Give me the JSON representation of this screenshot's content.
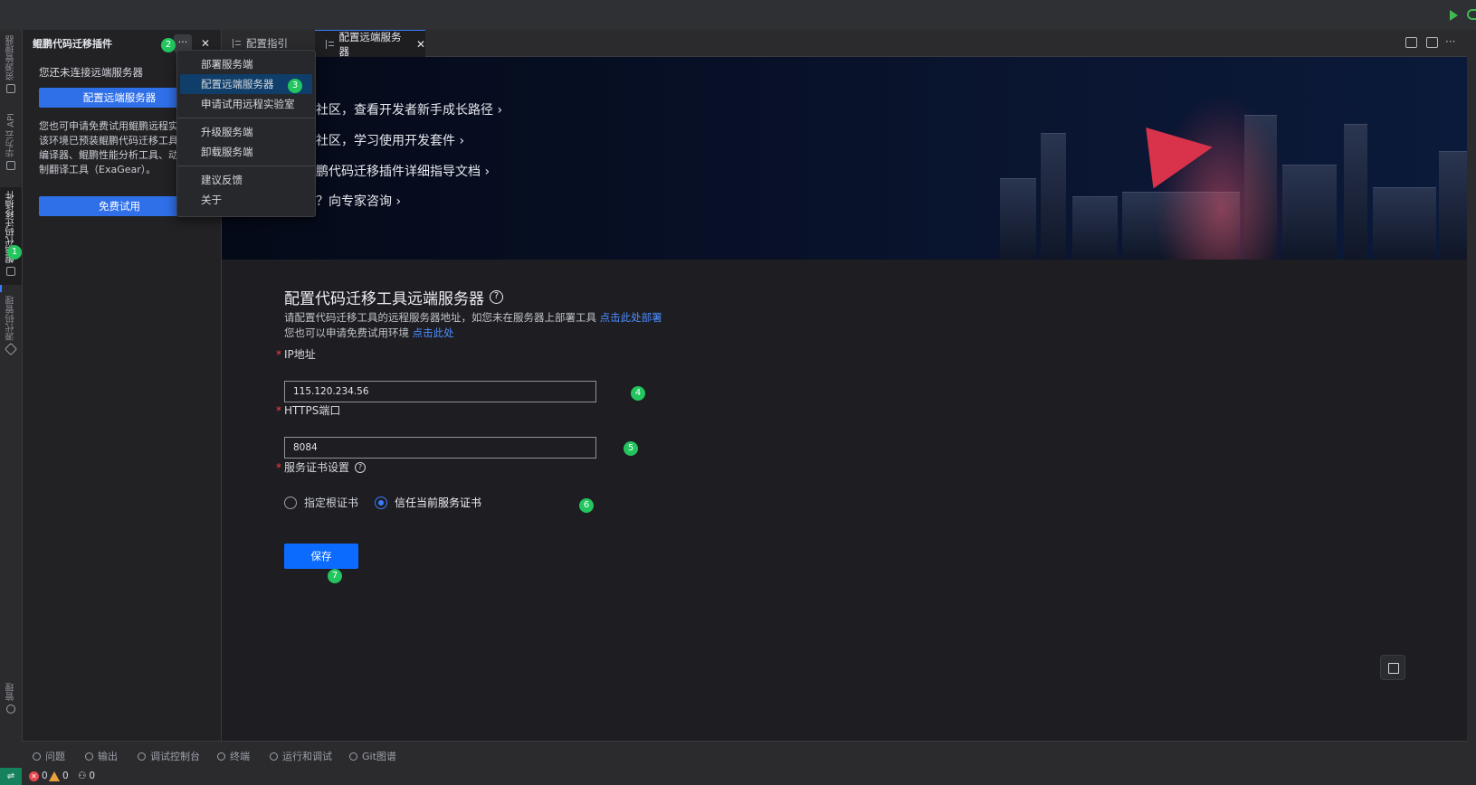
{
  "sidebar": {
    "title": "鲲鹏代码迁移插件",
    "status": "您还未连接远端服务器",
    "config_button": "配置远端服务器",
    "description": "您也可申请免费试用鲲鹏远程实验室，该环境已预装鲲鹏代码迁移工具、鲲鹏编译器、鲲鹏性能分析工具、动态二进制翻译工具（ExaGear）。",
    "trial_button": "免费试用",
    "more_label": "···",
    "close_label": "✕"
  },
  "activity_bar": {
    "items": [
      "资源管理器",
      "华为云 API",
      "鲲鹏代码迁移插件",
      "源代码管理",
      "管理"
    ]
  },
  "menu": {
    "items": [
      "部署服务端",
      "配置远端服务器",
      "申请试用远程实验室",
      "升级服务端",
      "卸载服务端",
      "建议反馈",
      "关于"
    ],
    "selected": "配置远端服务器"
  },
  "markers": [
    "1",
    "2",
    "3",
    "4",
    "5",
    "6",
    "7"
  ],
  "tabs": [
    {
      "label": "配置指引"
    },
    {
      "label": "配置远端服务器",
      "close": "✕"
    }
  ],
  "banner": {
    "lines": [
      "鹏社区，查看开发者新手成长路径 ›",
      "鹏社区，学习使用开发套件 ›",
      "鲲鹏代码迁移插件详细指导文档 ›",
      "问？向专家咨询 ›"
    ]
  },
  "form": {
    "title": "配置代码迁移工具远端服务器",
    "desc1": "请配置代码迁移工具的远程服务器地址，如您未在服务器上部署工具",
    "desc1_link": "点击此处部署",
    "desc2": "您也可以申请免费试用环境",
    "desc2_link": "点击此处",
    "ip_label": "IP地址",
    "ip_value": "115.120.234.56",
    "port_label": "HTTPS端口",
    "port_value": "8084",
    "cert_label": "服务证书设置",
    "radio_root": "指定根证书",
    "radio_trust": "信任当前服务证书",
    "radio_selected": "信任当前服务证书",
    "save": "保存",
    "required_mark": "*",
    "help_mark": "?"
  },
  "panel": {
    "tabs": [
      "问题",
      "输出",
      "调试控制台",
      "终端",
      "运行和调试",
      "Git图谱"
    ]
  },
  "status": {
    "errors": "0",
    "warnings": "0",
    "ports": "0",
    "remote_icon": "⇌"
  },
  "colors": {
    "accent": "#0c6bff",
    "marker": "#22c55e",
    "link": "#4c8dff",
    "required": "#ef4444"
  }
}
